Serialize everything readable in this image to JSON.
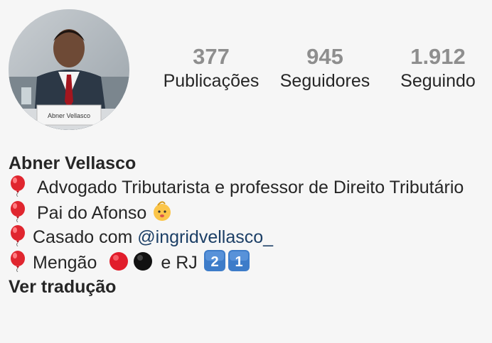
{
  "profile": {
    "avatar_caption": "Abner Vellasco",
    "stats": [
      {
        "value": "377",
        "label": "Publicações"
      },
      {
        "value": "945",
        "label": "Seguidores"
      },
      {
        "value": "1.912",
        "label": "Seguindo"
      }
    ]
  },
  "bio": {
    "name": "Abner Vellasco",
    "line1": "Advogado Tributarista e professor de Direito Tributário",
    "line2": "Pai do Afonso",
    "line3_prefix": "Casado com ",
    "line3_mention": "@ingridvellasco_",
    "line4_a": "Mengão",
    "line4_b": "e RJ",
    "keycap_1": "2",
    "keycap_2": "1",
    "translate": "Ver tradução"
  },
  "icons": {
    "balloon": "red-balloon-icon",
    "baby": "baby-face-icon",
    "red_ball": "red-circle-icon",
    "black_ball": "black-circle-icon",
    "keycap": "keycap-digit-icon"
  },
  "colors": {
    "stat_number": "#8e8e8e",
    "text": "#262626",
    "mention": "#1c3f66",
    "balloon": "#e0262f",
    "keycap": "#3d7cc9"
  }
}
